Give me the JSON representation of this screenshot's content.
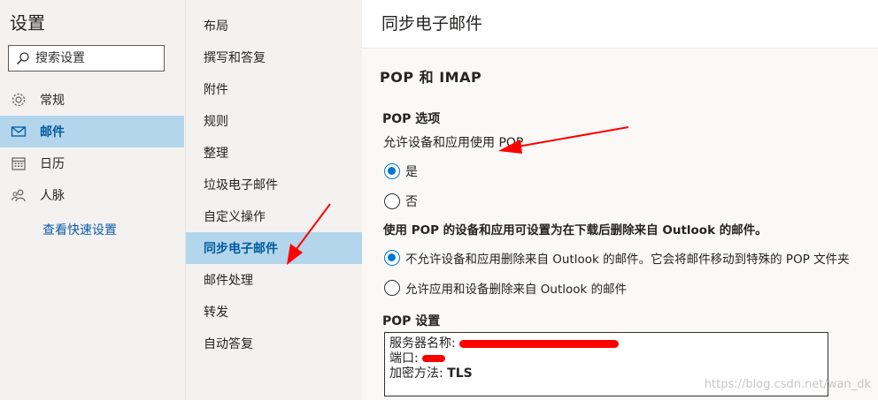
{
  "app": {
    "title": "设置"
  },
  "search": {
    "placeholder": "搜索设置"
  },
  "sidebar": {
    "items": [
      {
        "label": "常规",
        "icon": "gear-icon"
      },
      {
        "label": "邮件",
        "icon": "mail-icon"
      },
      {
        "label": "日历",
        "icon": "calendar-icon"
      },
      {
        "label": "人脉",
        "icon": "people-icon"
      }
    ],
    "quick_link": "查看快速设置",
    "active_index": 1
  },
  "subnav": {
    "items": [
      "布局",
      "撰写和答复",
      "附件",
      "规则",
      "整理",
      "垃圾电子邮件",
      "自定义操作",
      "同步电子邮件",
      "邮件处理",
      "转发",
      "自动答复"
    ],
    "active_index": 7
  },
  "main": {
    "page_title": "同步电子邮件",
    "section_title": "POP 和 IMAP",
    "pop_options_heading": "POP 选项",
    "allow_pop_question": "允许设备和应用使用 POP",
    "yes_label": "是",
    "no_label": "否",
    "delete_question": "使用 POP 的设备和应用可设置为在下载后删除来自 Outlook 的邮件。",
    "option_no_delete": "不允许设备和应用删除来自 Outlook 的邮件。它会将邮件移动到特殊的 POP 文件夹",
    "option_allow_delete": "允许应用和设备删除来自 Outlook 的邮件",
    "pop_settings_heading": "POP 设置",
    "server_label": "服务器名称:",
    "port_label": "端口:",
    "encryption_label": "加密方法:",
    "encryption_value": "TLS"
  },
  "watermark": "https://blog.csdn.net/wan_dk",
  "colors": {
    "accent": "#0078d4",
    "selected_bg": "#b3d6ec",
    "annotation_red": "#ff0000"
  }
}
